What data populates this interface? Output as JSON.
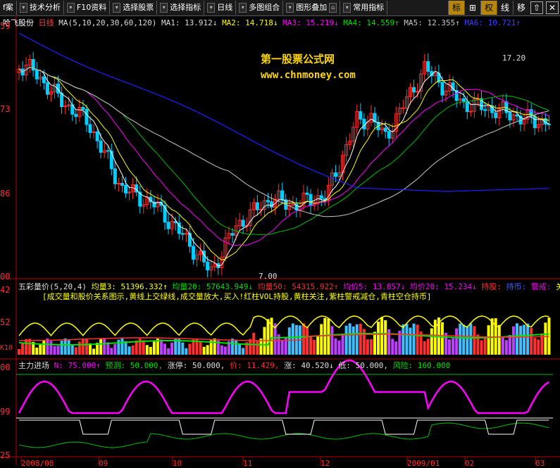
{
  "toolbar": {
    "items": [
      "f案",
      "技术分析",
      "F10资料",
      "选择股票",
      "选择指标",
      "日线",
      "多图组合",
      "图形叠加",
      "常用指标"
    ],
    "right": [
      "标",
      "⊞",
      "权",
      "线",
      "移",
      "⇧",
      "✕"
    ]
  },
  "main_panel": {
    "stock_name": "哈飞股份",
    "period": "日线",
    "ma_params": "MA(5,10,20,30,60,120)",
    "ma1": "MA1: 13.912↓",
    "ma2": "MA2: 14.718↓",
    "ma3": "MA3: 15.219↓",
    "ma4": "MA4: 14.559↑",
    "ma5": "MA5: 12.355↑",
    "ma6": "MA6: 10.721↑",
    "y_labels": [
      "59",
      "73",
      "86",
      "00"
    ],
    "high_label": "17.20",
    "low_label": "7.00",
    "watermark_title": "第一股票公式网",
    "watermark_url": "www.chnmoney.com"
  },
  "volume_panel": {
    "title": "五彩量价(5,20,4)",
    "avg3": "均量3: 51396.332↑",
    "avg20": "均量20: 57643.949↓",
    "avg50": "均量50: 54315.922↑",
    "price5": "均价5: 13.857↓",
    "price20": "均价20: 15.234↓",
    "hold": "持股:",
    "cash": "持币:",
    "alert": "警戒:",
    "guan": "关",
    "desc": "[成交量和股价关系图示,黄线上交绿线,成交量放大,买入!红柱VOL持股,黄柱关注,紫柱警戒减仓,青柱空仓持币]",
    "y_labels": [
      "42",
      "52",
      "K10"
    ]
  },
  "indicator_panel": {
    "title": "主力进场",
    "n": "N: 75.000↑",
    "predict": "预测: 50.000,",
    "limit_up": "涨停: 50.000,",
    "price": "价: 11.429,",
    "rise": "涨: 40.520↓",
    "low": "低: 50.000,",
    "risk": "风险: 160.000",
    "y_labels": [
      "00",
      "99",
      "25"
    ]
  },
  "date_axis": [
    "2008/08",
    "09",
    "10",
    "11",
    "12",
    "2009/01",
    "02",
    "03"
  ],
  "colors": {
    "up": "#ff3030",
    "down": "#00d0ff",
    "ma_white": "#ffffff",
    "ma_yellow": "#ffff00",
    "ma_magenta": "#ff00ff",
    "ma_green": "#00c000",
    "ma_gray": "#c8c8c8",
    "ma_blue": "#2020ff"
  }
}
